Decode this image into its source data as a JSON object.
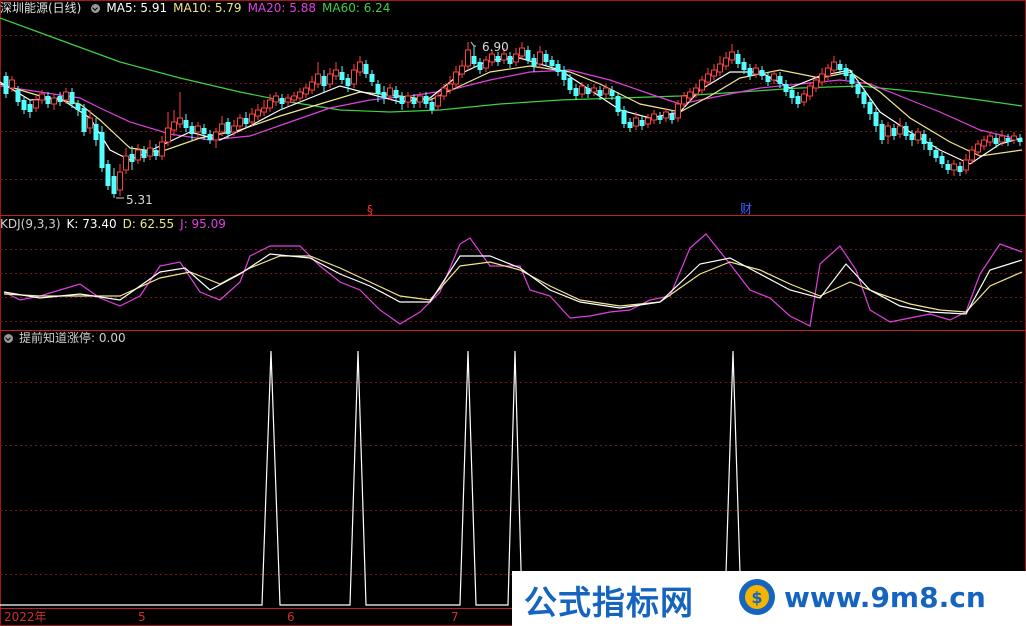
{
  "main": {
    "title": "深圳能源(日线)",
    "ma5": "MA5: 5.91",
    "ma10": "MA10: 5.79",
    "ma20": "MA20: 5.88",
    "ma60": "MA60: 6.24",
    "high_label": "6.90",
    "low_label": "5.31",
    "marker_1": "§",
    "marker_2": "财"
  },
  "kdj": {
    "title": "KDJ(9,3,3)",
    "k": "K: 73.40",
    "d": "D: 62.55",
    "j": "J: 95.09"
  },
  "signal": {
    "title": "提前知道涨停",
    "value": ": 0.00"
  },
  "axis": {
    "year": "2022年",
    "m5": "5",
    "m6": "6",
    "m7": "7"
  },
  "watermark": {
    "left": "公式指标网",
    "right": "www.9m8.cn"
  },
  "colors": {
    "up": "#ff4040",
    "down": "#54ffff",
    "ma5": "#ffffff",
    "ma10": "#f0e68c",
    "ma20": "#e040e0",
    "ma60": "#40d040"
  }
}
